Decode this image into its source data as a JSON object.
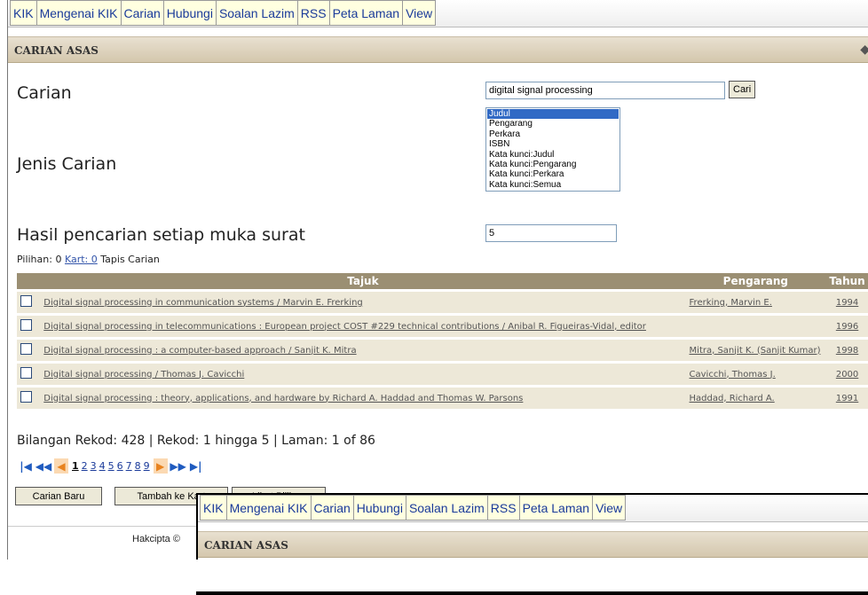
{
  "menu": [
    "KIK",
    "Mengenai KIK",
    "Carian",
    "Hubungi",
    "Soalan Lazim",
    "RSS",
    "Peta Laman",
    "View"
  ],
  "section_title": "CARIAN ASAS",
  "form": {
    "search_label": "Carian",
    "search_value": "digital signal processing",
    "search_button": "Cari",
    "type_label": "Jenis Carian",
    "type_options": [
      "Judul",
      "Pengarang",
      "Perkara",
      "ISBN",
      "Kata kunci:Judul",
      "Kata kunci:Pengarang",
      "Kata kunci:Perkara",
      "Kata kunci:Semua"
    ],
    "type_selected": "Judul",
    "per_page_label": "Hasil pencarian setiap muka surat",
    "per_page_value": "5"
  },
  "filter": {
    "prefix": "Pilihan: 0",
    "cart_link": "Kart: 0",
    "suffix": "Tapis Carian"
  },
  "table": {
    "headers": [
      "Tajuk",
      "Pengarang",
      "Tahun"
    ],
    "rows": [
      {
        "title": "Digital signal processing in communication systems / Marvin E. Frerking",
        "author": "Frerking, Marvin E.",
        "year": "1994"
      },
      {
        "title": "Digital signal processing in telecommunications : European project COST #229 technical contributions / Anibal R. Figueiras-Vidal, editor",
        "author": "",
        "year": "1996"
      },
      {
        "title": "Digital signal processing : a computer-based approach / Sanjit K. Mitra",
        "author": "Mitra, Sanjit K. (Sanjit Kumar)",
        "year": "1998"
      },
      {
        "title": "Digital signal processing / Thomas J. Cavicchi",
        "author": "Cavicchi, Thomas J.",
        "year": "2000"
      },
      {
        "title": "Digital signal processing : theory, applications, and hardware by Richard A. Haddad and Thomas W. Parsons",
        "author": "Haddad, Richard A.",
        "year": "1991"
      }
    ]
  },
  "summary": "Bilangan Rekod: 428  |  Rekod: 1 hingga 5  |  Laman: 1 of 86",
  "pager": {
    "pages": [
      "1",
      "2",
      "3",
      "4",
      "5",
      "6",
      "7",
      "8",
      "9"
    ],
    "current": "1",
    "icons": [
      "first-page-icon",
      "previous-block-icon",
      "previous-page-icon",
      "next-page-icon",
      "next-block-icon",
      "last-page-icon"
    ]
  },
  "buttons": {
    "new_search": "Carian Baru",
    "add_to_cart": "Tambah ke Kart",
    "view_selection": "Lihat Pilihan"
  },
  "footer": {
    "copyright": "Hakcipta ©"
  },
  "overlay_window": {
    "menu": [
      "KIK",
      "Mengenai KIK",
      "Carian",
      "Hubungi",
      "Soalan Lazim",
      "RSS",
      "Peta Laman",
      "View"
    ],
    "section_title": "CARIAN ASAS"
  },
  "colors": {
    "menu_link": "#1a3a9a",
    "header_bar": "#d4c7ad",
    "table_header": "#9b8f73",
    "row_bg": "#ede8d8",
    "listbox_selected": "#316ac5"
  }
}
